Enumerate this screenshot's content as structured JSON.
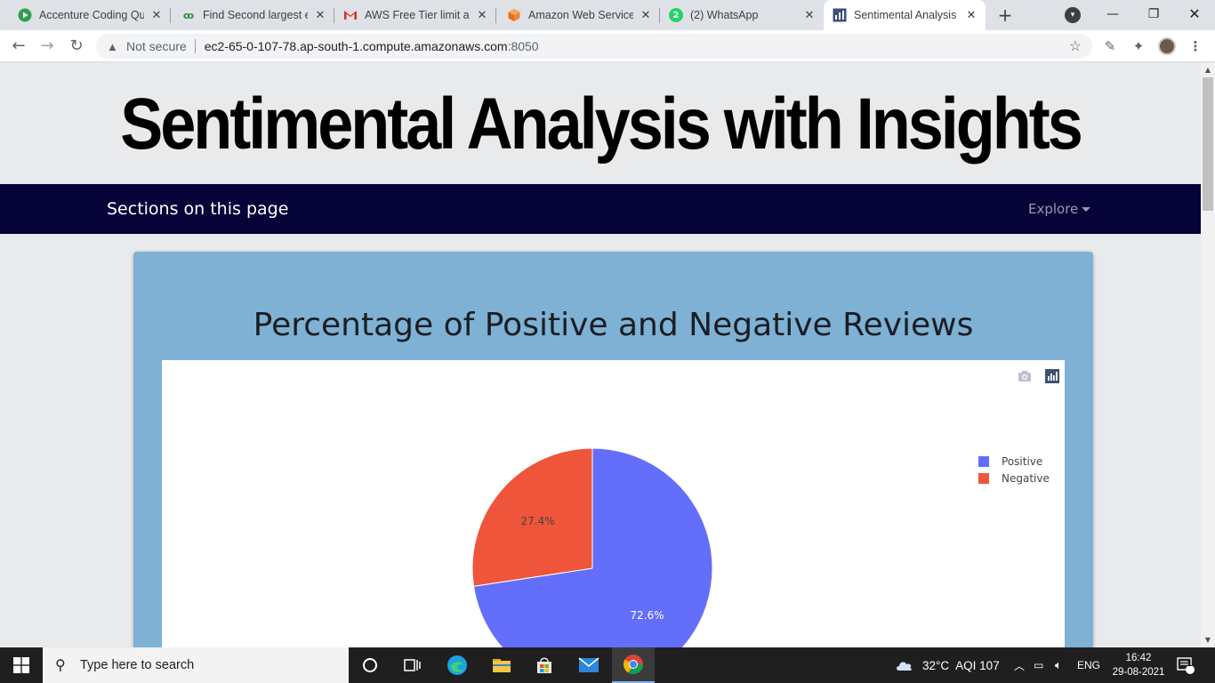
{
  "browser": {
    "tabs": [
      {
        "title": "Accenture Coding Que",
        "favicon": "play-icon",
        "active": false
      },
      {
        "title": "Find Second largest el",
        "favicon": "geeks-icon",
        "active": false
      },
      {
        "title": "AWS Free Tier limit ale",
        "favicon": "gmail-icon",
        "active": false
      },
      {
        "title": "Amazon Web Services",
        "favicon": "aws-cube-icon",
        "active": false
      },
      {
        "title": "(2) WhatsApp",
        "favicon": "whatsapp-icon",
        "badge": "2",
        "active": false
      },
      {
        "title": "Sentimental Analysis a",
        "favicon": "chart-icon",
        "active": true
      }
    ],
    "address": {
      "security_label": "Not secure",
      "url_host": "ec2-65-0-107-78.ap-south-1.compute.amazonaws.com",
      "url_port": ":8050"
    }
  },
  "page": {
    "heading": "Sentimental Analysis with Insights",
    "navbar": {
      "brand": "Sections on this page",
      "explore_label": "Explore"
    },
    "card": {
      "title": "Percentage of Positive and Negative Reviews"
    }
  },
  "chart_data": {
    "type": "pie",
    "categories": [
      "Positive",
      "Negative"
    ],
    "values": [
      72.6,
      27.4
    ],
    "labels": [
      "72.6%",
      "27.4%"
    ],
    "colors": [
      "#636efa",
      "#ef553b"
    ],
    "legend_placement": "top-right"
  },
  "taskbar": {
    "search_placeholder": "Type here to search",
    "weather": "32°C",
    "aqi": "AQI 107",
    "language": "ENG",
    "time": "16:42",
    "date": "29-08-2021",
    "notification_count": "1"
  }
}
